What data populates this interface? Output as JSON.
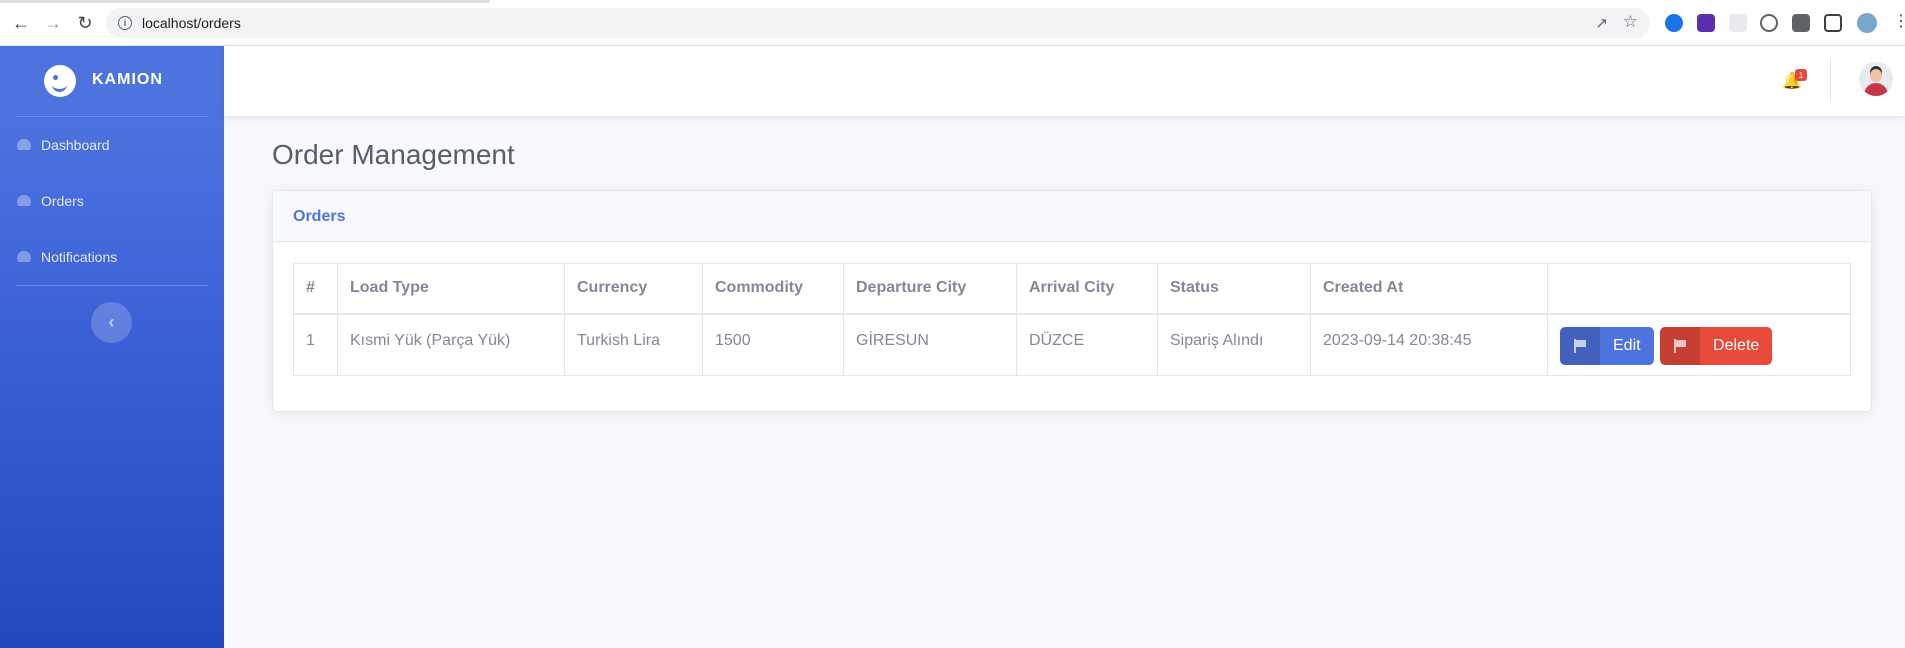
{
  "browser": {
    "url": "localhost/orders"
  },
  "sidebar": {
    "brand": "KAMION",
    "items": [
      {
        "label": "Dashboard",
        "icon": "tachometer-icon"
      },
      {
        "label": "Orders",
        "icon": "tachometer-icon"
      },
      {
        "label": "Notifications",
        "icon": "tachometer-icon"
      }
    ],
    "toggle_icon": "chevron-left-icon"
  },
  "topbar": {
    "notification_count": "1"
  },
  "main": {
    "page_title": "Order Management",
    "card_title": "Orders",
    "table": {
      "columns": [
        "#",
        "Load Type",
        "Currency",
        "Commodity",
        "Departure City",
        "Arrival City",
        "Status",
        "Created At",
        ""
      ],
      "rows": [
        {
          "id": "1",
          "load_type": "Kısmi Yük (Parça Yük)",
          "currency": "Turkish Lira",
          "commodity": "1500",
          "departure_city": "GİRESUN",
          "arrival_city": "DÜZCE",
          "status": "Sipariş Alındı",
          "created_at": "2023-09-14 20:38:45",
          "edit_label": "Edit",
          "delete_label": "Delete"
        }
      ]
    }
  },
  "colors": {
    "primary": "#4e73df",
    "danger": "#e74a3b",
    "text": "#858796"
  }
}
